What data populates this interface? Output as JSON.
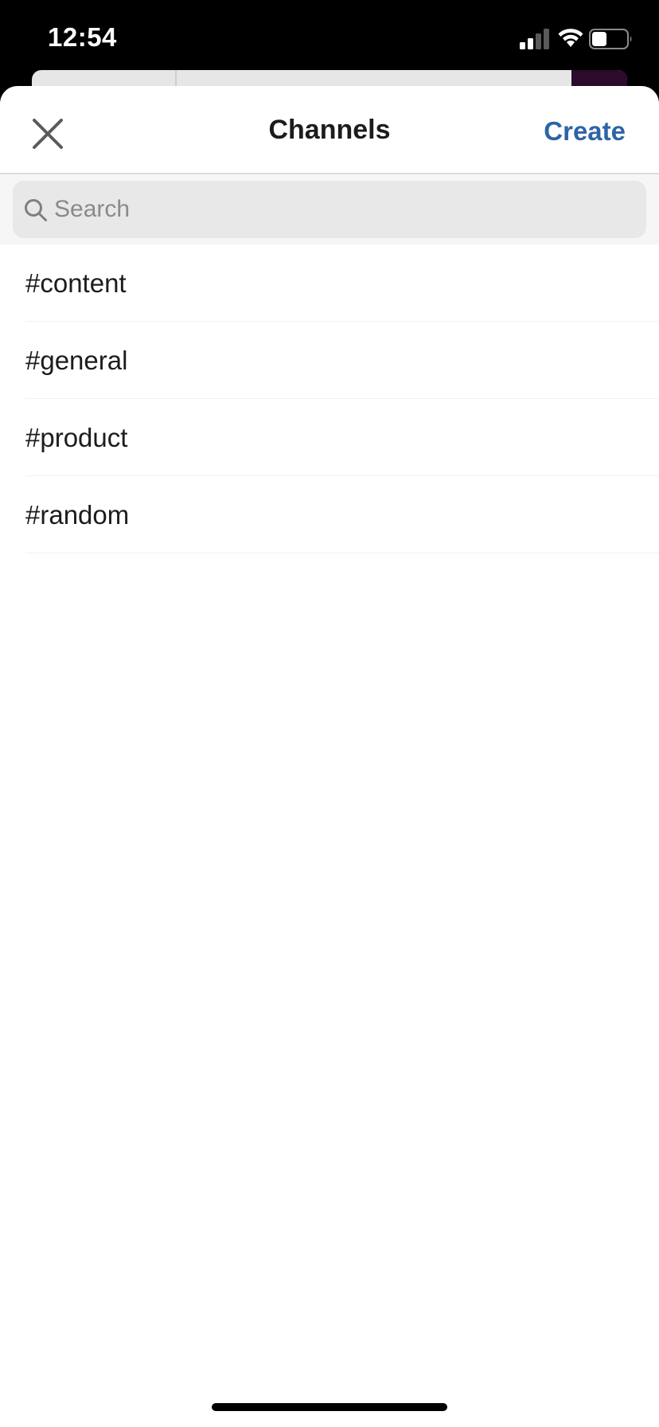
{
  "status_bar": {
    "time": "12:54",
    "signal_icon": "cellular-signal-icon",
    "wifi_icon": "wifi-icon",
    "battery_icon": "battery-icon",
    "battery_level": 0.4
  },
  "sheet": {
    "title": "Channels",
    "close_icon": "close-icon",
    "create_label": "Create"
  },
  "search": {
    "placeholder": "Search",
    "value": "",
    "icon": "search-icon"
  },
  "channels": [
    {
      "label": "#content"
    },
    {
      "label": "#general"
    },
    {
      "label": "#product"
    },
    {
      "label": "#random"
    }
  ],
  "colors": {
    "accent": "#2d64a7",
    "text": "#1d1c1d",
    "search_bg": "#e8e8e8",
    "status_bar_bg": "#000000"
  }
}
